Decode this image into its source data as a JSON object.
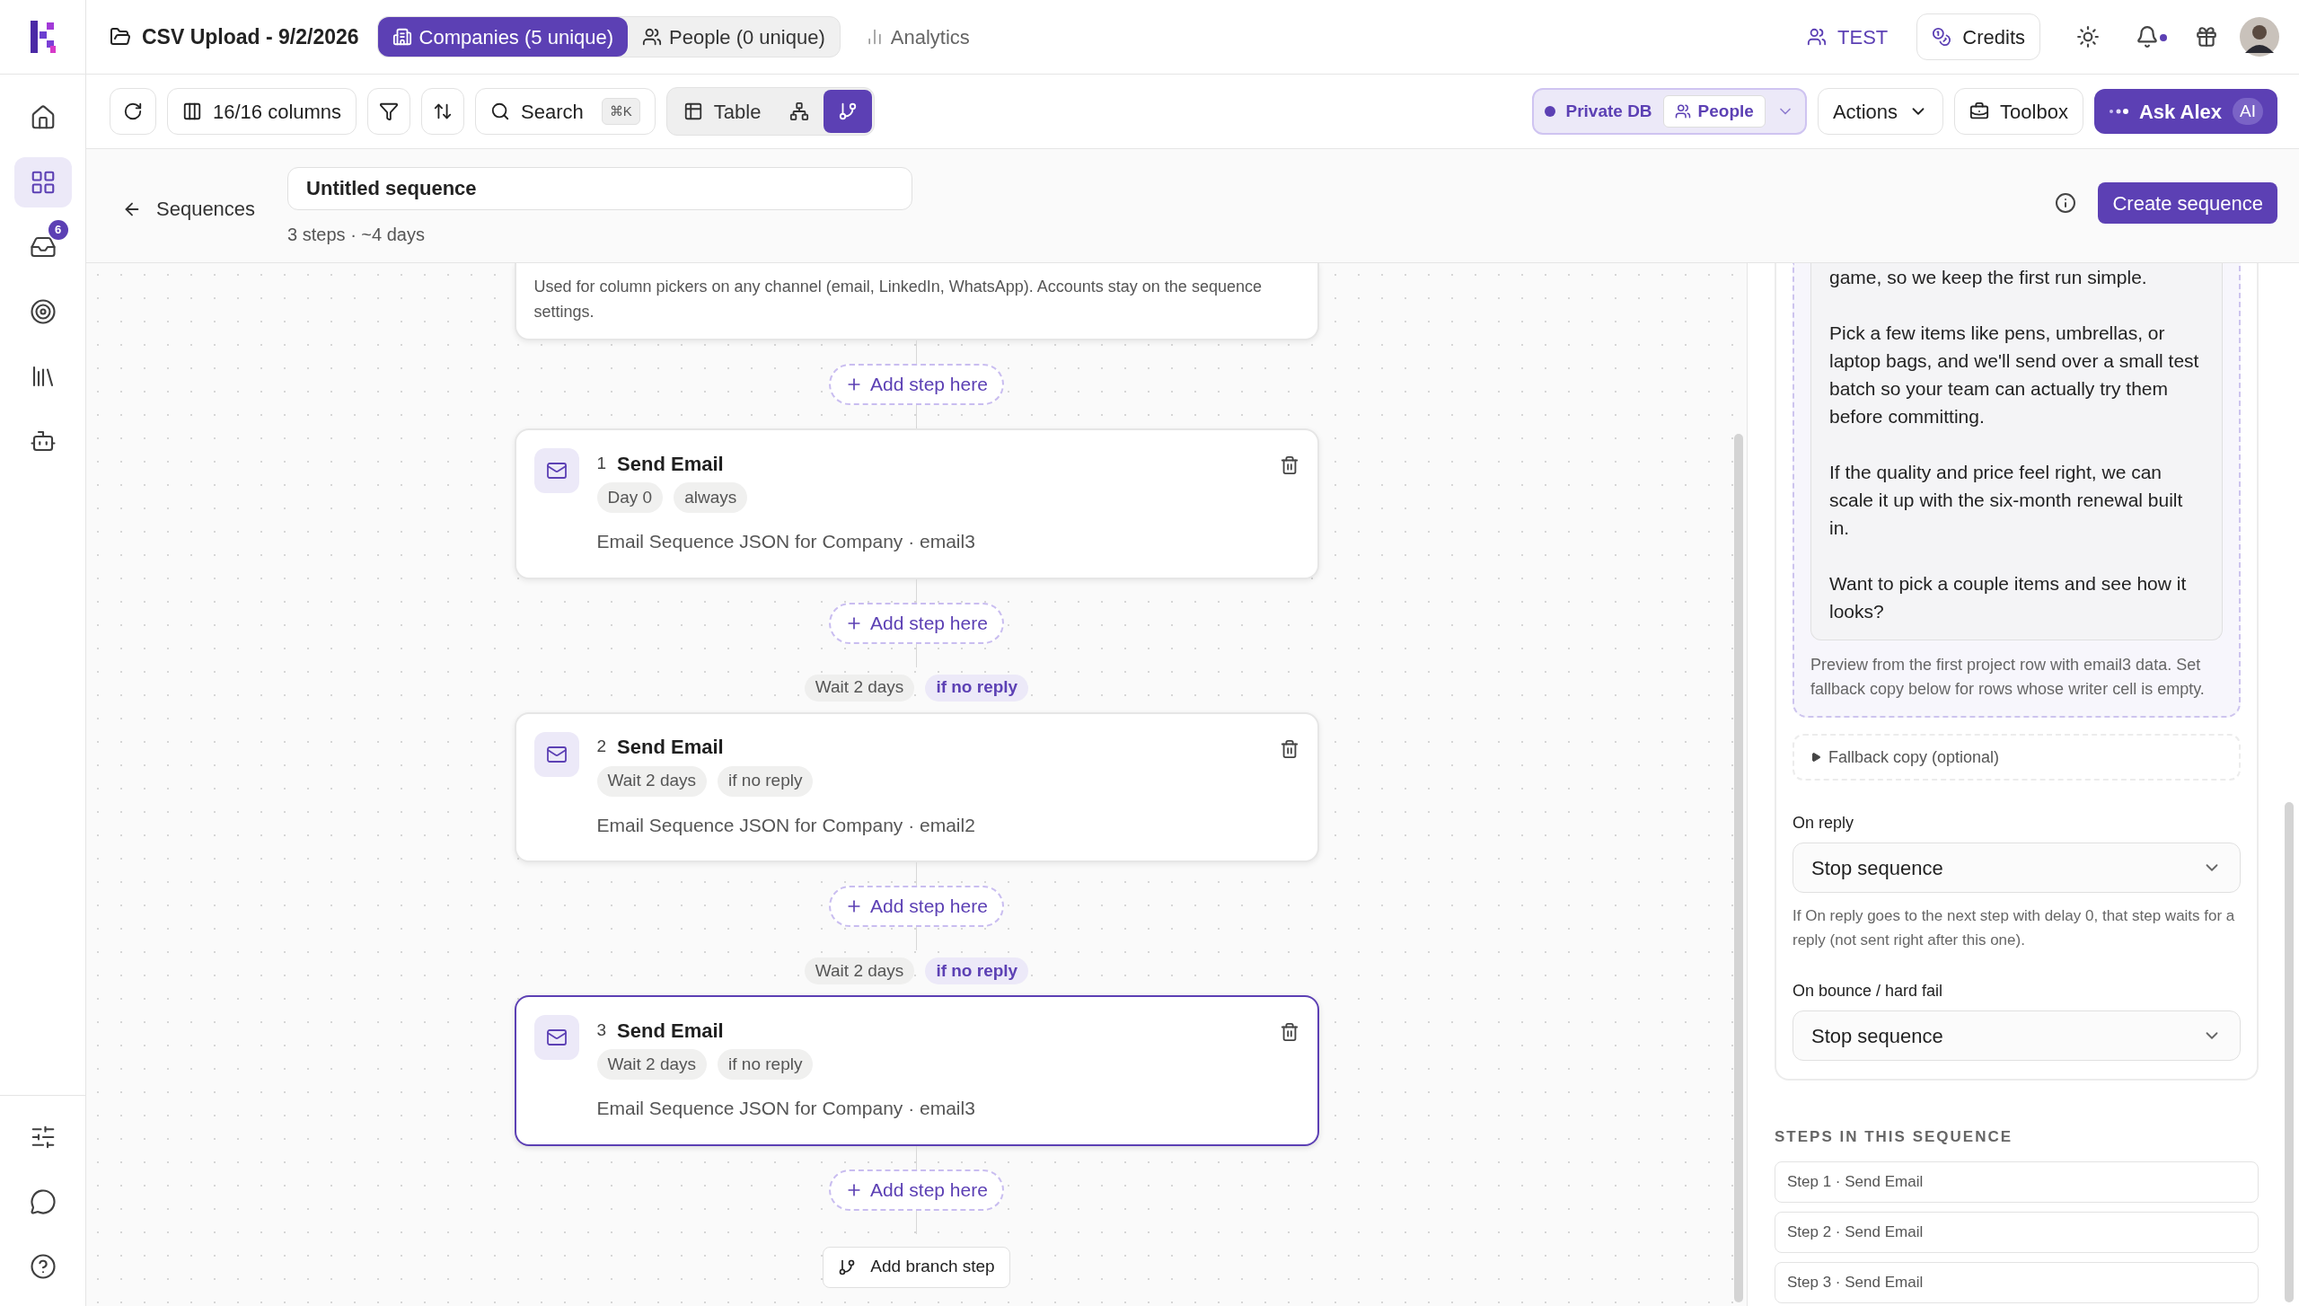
{
  "rail": {
    "items": [
      {
        "kind": "home",
        "selected": false
      },
      {
        "kind": "grid",
        "selected": true
      },
      {
        "kind": "inbox",
        "selected": false,
        "badge": "6"
      },
      {
        "kind": "target",
        "selected": false
      },
      {
        "kind": "library",
        "selected": false
      },
      {
        "kind": "bot",
        "selected": false
      }
    ],
    "footer_items": [
      {
        "kind": "sliders"
      },
      {
        "kind": "chat"
      },
      {
        "kind": "help"
      }
    ]
  },
  "top_bar": {
    "file_title": "CSV Upload - 9/2/2026",
    "tabs": [
      {
        "kind": "companies",
        "label": "Companies (5 unique)",
        "selected": true
      },
      {
        "kind": "people",
        "label": "People (0 unique)",
        "selected": false
      },
      {
        "kind": "analytics",
        "label": "Analytics",
        "selected": false
      }
    ],
    "workspace": "TEST",
    "credits": "Credits",
    "notifications_unread": true
  },
  "toolbar": {
    "columns": "16/16 columns",
    "search": "Search",
    "shortcut": "⌘K",
    "views": [
      {
        "kind": "table",
        "label": "Table",
        "selected": false
      },
      {
        "kind": "diagram",
        "selected": false
      },
      {
        "kind": "branch",
        "selected": true
      }
    ],
    "db": "Private DB",
    "db_scope": "People",
    "actions": "Actions",
    "toolbox": "Toolbox",
    "ask": "Ask Alex",
    "ask_badge": "AI"
  },
  "header": {
    "back": "Sequences",
    "name": "Untitled sequence",
    "summary": "3 steps · ~4 days",
    "create": "Create sequence"
  },
  "canvas": {
    "intro_note": "Used for column pickers on any channel (email, LinkedIn, WhatsApp). Accounts stay on the sequence settings.",
    "add_step_buttons": [
      "Add step here",
      "Add step here",
      "Add step here",
      "Add step here"
    ],
    "steps": [
      {
        "number": "1",
        "title": "Send Email",
        "tags": [
          "Day 0",
          "always"
        ],
        "source": "Email Sequence JSON for Company · email3",
        "selected": false
      },
      {
        "number": "2",
        "title": "Send Email",
        "tags": [
          "Wait 2 days",
          "if no reply"
        ],
        "source": "Email Sequence JSON for Company · email2",
        "selected": false,
        "connector": {
          "wait": "Wait 2 days",
          "condition": "if no reply"
        }
      },
      {
        "number": "3",
        "title": "Send Email",
        "tags": [
          "Wait 2 days",
          "if no reply"
        ],
        "source": "Email Sequence JSON for Company · email3",
        "selected": true,
        "connector": {
          "wait": "Wait 2 days",
          "condition": "if no reply"
        }
      }
    ],
    "branch_button": "Add branch step"
  },
  "panel": {
    "preview_paragraphs": [
      "game, so we keep the first run simple.",
      "Pick a few items like pens, umbrellas, or laptop bags, and we'll send over a small test batch so your team can actually try them before committing.",
      "If the quality and price feel right, we can scale it up with the six-month renewal built in.",
      "Want to pick a couple items and see how it looks?"
    ],
    "preview_note": "Preview from the first project row with email3 data. Set fallback copy below for rows whose writer cell is empty.",
    "fallback": {
      "label": "Fallback copy (optional)",
      "expanded": false
    },
    "on_reply": {
      "label": "On reply",
      "value": "Stop sequence"
    },
    "on_reply_help": "If On reply goes to the next step with delay 0, that step waits for a reply (not sent right after this one).",
    "on_bounce": {
      "label": "On bounce / hard fail",
      "value": "Stop sequence"
    },
    "steps_heading": "STEPS IN THIS SEQUENCE",
    "step_links": [
      "Step 1 · Send Email",
      "Step 2 · Send Email",
      "Step 3 · Send Email"
    ]
  }
}
